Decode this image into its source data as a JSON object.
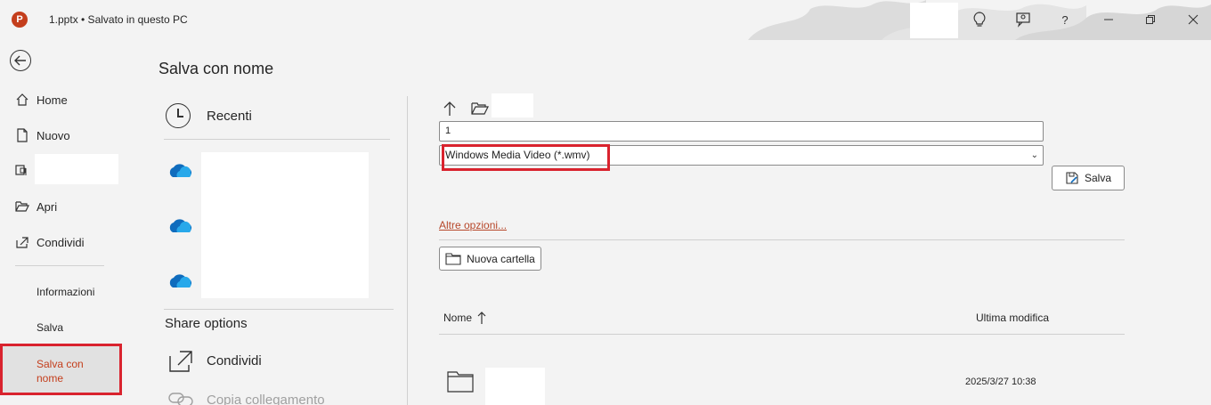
{
  "titlebar": {
    "app_icon_letter": "P",
    "doc_title": "1.pptx  •  Salvato in questo PC",
    "help_label": "?"
  },
  "nav": {
    "home": "Home",
    "new": "Nuovo",
    "open": "Apri",
    "share": "Condividi",
    "info": "Informazioni",
    "save": "Salva",
    "save_as": "Salva con nome"
  },
  "page": {
    "title": "Salva con nome"
  },
  "locations": {
    "recent": "Recenti",
    "share_options_title": "Share options",
    "share": "Condividi",
    "copy_link": "Copia collegamento"
  },
  "file": {
    "filename_value": "1",
    "filetype_value": "Windows Media Video (*.wmv)",
    "save_button": "Salva",
    "more_options": "Altre opzioni...",
    "new_folder": "Nuova cartella",
    "col_name": "Nome",
    "col_modified": "Ultima modifica",
    "rows": [
      {
        "date": "2025/3/27 10:38"
      }
    ]
  },
  "colors": {
    "accent": "#c43e1c",
    "highlight_border": "#d9232e",
    "onedrive": "#0f6cbd"
  }
}
